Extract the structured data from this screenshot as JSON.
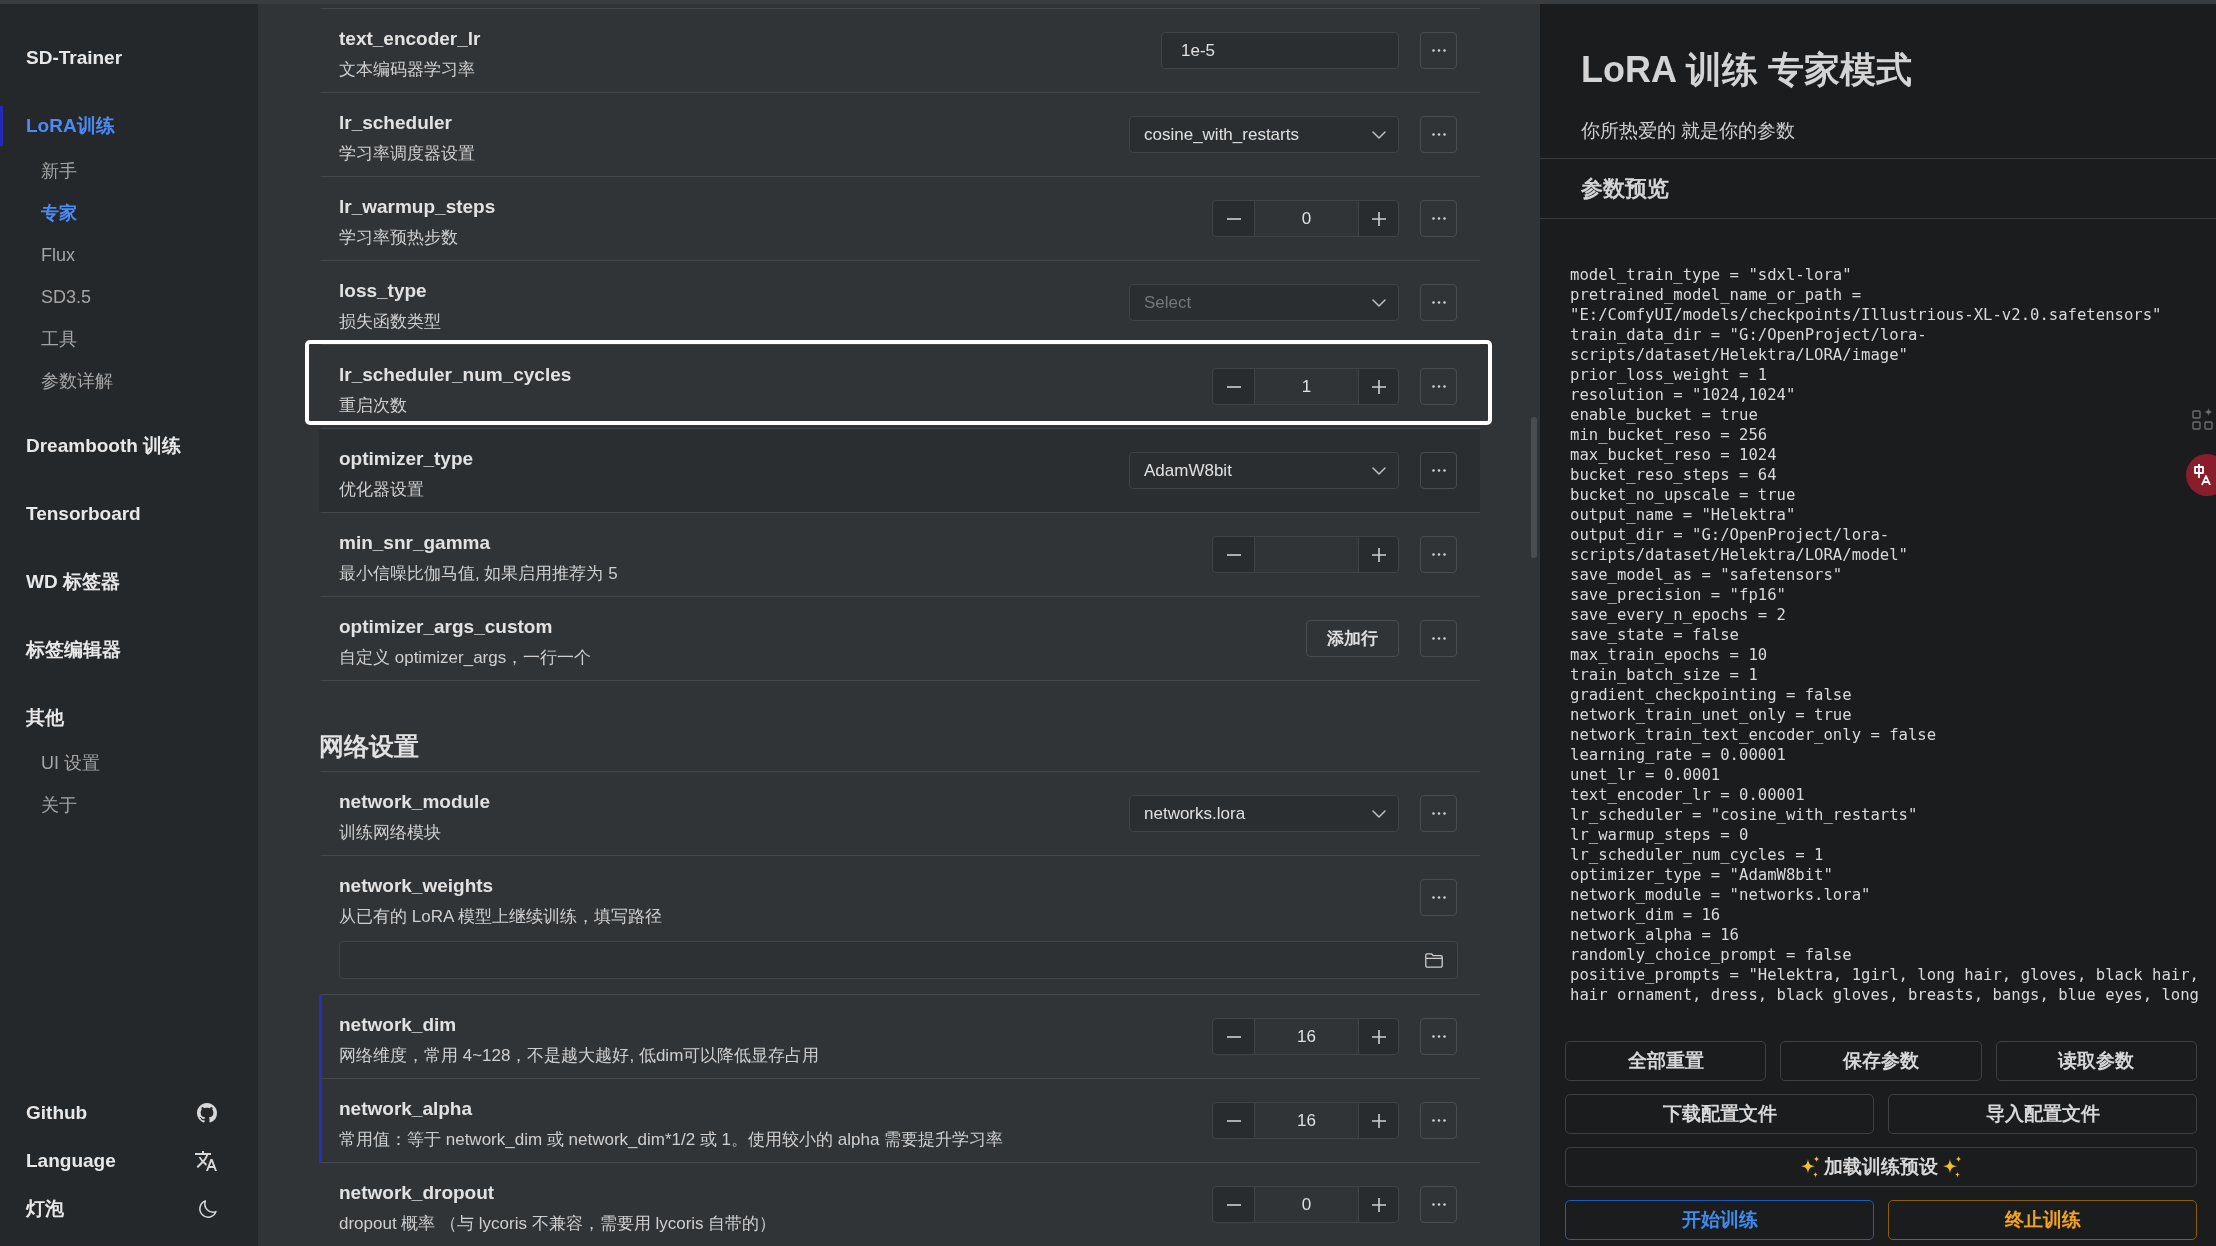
{
  "sidebar": {
    "brand": "SD-Trainer",
    "sections": [
      {
        "label": "LoRA训练",
        "selected": true,
        "children": [
          {
            "label": "新手",
            "selected": false
          },
          {
            "label": "专家",
            "selected": true
          },
          {
            "label": "Flux",
            "selected": false
          },
          {
            "label": "SD3.5",
            "selected": false
          },
          {
            "label": "工具",
            "selected": false
          },
          {
            "label": "参数详解",
            "selected": false
          }
        ]
      },
      {
        "label": "Dreambooth 训练",
        "selected": false
      },
      {
        "label": "Tensorboard",
        "selected": false
      },
      {
        "label": "WD 标签器",
        "selected": false
      },
      {
        "label": "标签编辑器",
        "selected": false
      },
      {
        "label": "其他",
        "selected": false,
        "children": [
          {
            "label": "UI 设置",
            "selected": false
          },
          {
            "label": "关于",
            "selected": false
          }
        ]
      }
    ],
    "footer": [
      {
        "label": "Github",
        "kind": "github"
      },
      {
        "label": "Language",
        "kind": "language"
      },
      {
        "label": "灯泡",
        "kind": "theme"
      }
    ]
  },
  "main": {
    "groups": [
      {
        "rows": [
          {
            "param": "text_encoder_lr",
            "description": "文本编码器学习率",
            "kind": "text",
            "value": "1e-5",
            "focused": false,
            "hovered": false,
            "modified": false
          },
          {
            "param": "lr_scheduler",
            "description": "学习率调度器设置",
            "kind": "select",
            "value": "cosine_with_restarts",
            "focused": false,
            "hovered": false,
            "modified": false
          },
          {
            "param": "lr_warmup_steps",
            "description": "学习率预热步数",
            "kind": "number",
            "value": "0",
            "focused": false,
            "hovered": false,
            "modified": false
          },
          {
            "param": "loss_type",
            "description": "损失函数类型",
            "kind": "select",
            "placeholder": "Select",
            "focused": false,
            "hovered": false,
            "modified": false
          },
          {
            "param": "lr_scheduler_num_cycles",
            "description": "重启次数",
            "kind": "number",
            "value": "1",
            "focused": true,
            "hovered": false,
            "modified": false
          },
          {
            "param": "optimizer_type",
            "description": "优化器设置",
            "kind": "select",
            "value": "AdamW8bit",
            "focused": false,
            "hovered": true,
            "modified": false
          },
          {
            "param": "min_snr_gamma",
            "description": "最小信噪比伽马值, 如果启用推荐为 5",
            "kind": "number",
            "focused": false,
            "hovered": false,
            "modified": false
          },
          {
            "param": "optimizer_args_custom",
            "description": "自定义 optimizer_args，一行一个",
            "kind": "button",
            "button_label": "添加行",
            "focused": false,
            "hovered": false,
            "modified": false
          }
        ]
      },
      {
        "title": "网络设置",
        "rows": [
          {
            "param": "network_module",
            "description": "训练网络模块",
            "kind": "select",
            "value": "networks.lora",
            "focused": false,
            "hovered": false,
            "modified": false
          },
          {
            "param": "network_weights",
            "description": "从已有的 LoRA 模型上继续训练，填写路径",
            "kind": "path",
            "focused": false,
            "hovered": false,
            "modified": false
          },
          {
            "param": "network_dim",
            "description": "网络维度，常用 4~128，不是越大越好, 低dim可以降低显存占用",
            "kind": "number",
            "value": "16",
            "focused": false,
            "hovered": false,
            "modified": true
          },
          {
            "param": "network_alpha",
            "description": "常用值：等于 network_dim 或 network_dim*1/2 或 1。使用较小的 alpha 需要提升学习率",
            "kind": "number",
            "value": "16",
            "focused": false,
            "hovered": false,
            "modified": true
          },
          {
            "param": "network_dropout",
            "description": "dropout 概率 （与 lycoris 不兼容，需要用 lycoris 自带的）",
            "kind": "number",
            "value": "0",
            "focused": false,
            "hovered": false,
            "modified": false
          }
        ]
      }
    ]
  },
  "panel": {
    "title": "LoRA 训练 专家模式",
    "subtitle": "你所热爱的 就是你的参数",
    "preview_title": "参数预览",
    "preview_lines": [
      "model_train_type = \"sdxl-lora\"",
      "pretrained_model_name_or_path =",
      "\"E:/ComfyUI/models/checkpoints/Illustrious-XL-v2.0.safetensors\"",
      "train_data_dir = \"G:/OpenProject/lora-",
      "scripts/dataset/Helektra/LORA/image\"",
      "prior_loss_weight = 1",
      "resolution = \"1024,1024\"",
      "enable_bucket = true",
      "min_bucket_reso = 256",
      "max_bucket_reso = 1024",
      "bucket_reso_steps = 64",
      "bucket_no_upscale = true",
      "output_name = \"Helektra\"",
      "output_dir = \"G:/OpenProject/lora-",
      "scripts/dataset/Helektra/LORA/model\"",
      "save_model_as = \"safetensors\"",
      "save_precision = \"fp16\"",
      "save_every_n_epochs = 2",
      "save_state = false",
      "max_train_epochs = 10",
      "train_batch_size = 1",
      "gradient_checkpointing = false",
      "network_train_unet_only = true",
      "network_train_text_encoder_only = false",
      "learning_rate = 0.00001",
      "unet_lr = 0.0001",
      "text_encoder_lr = 0.00001",
      "lr_scheduler = \"cosine_with_restarts\"",
      "lr_warmup_steps = 0",
      "lr_scheduler_num_cycles = 1",
      "optimizer_type = \"AdamW8bit\"",
      "network_module = \"networks.lora\"",
      "network_dim = 16",
      "network_alpha = 16",
      "randomly_choice_prompt = false",
      "positive_prompts = \"Helektra, 1girl, long hair, gloves, black hair,",
      "hair ornament, dress, black gloves, breasts, bangs, blue eyes, long"
    ],
    "button_rows": [
      [
        {
          "label": "全部重置",
          "kind": "default"
        },
        {
          "label": "保存参数",
          "kind": "default"
        },
        {
          "label": "读取参数",
          "kind": "default"
        }
      ],
      [
        {
          "label": "下载配置文件",
          "kind": "default"
        },
        {
          "label": "导入配置文件",
          "kind": "default"
        }
      ],
      [
        {
          "label": "加载训练预设",
          "kind": "preset"
        }
      ],
      [
        {
          "label": "开始训练",
          "kind": "primary"
        },
        {
          "label": "终止训练",
          "kind": "warning"
        }
      ]
    ]
  }
}
